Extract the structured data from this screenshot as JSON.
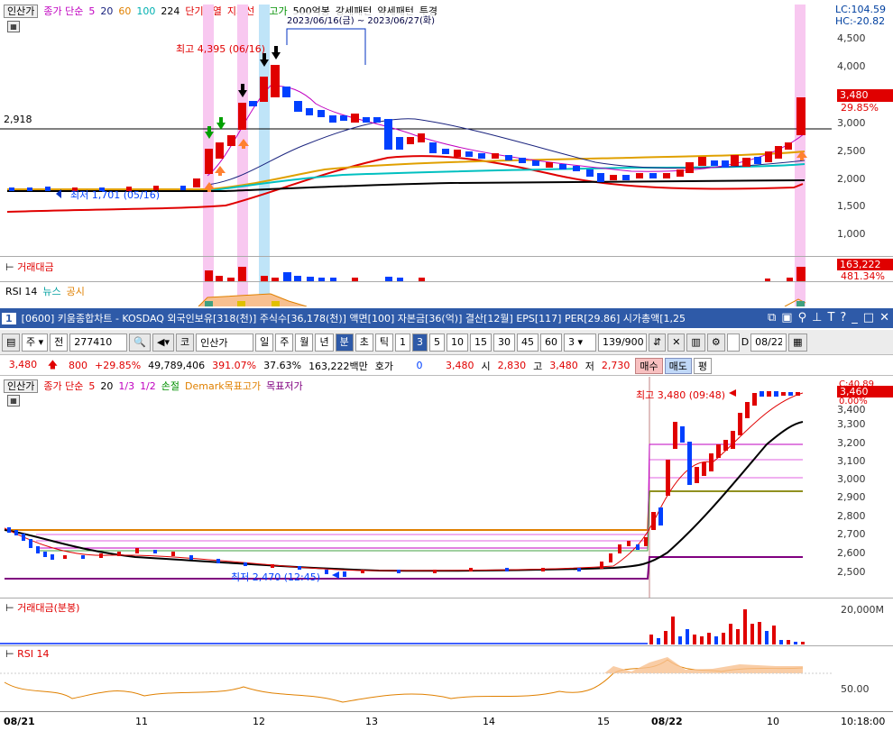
{
  "top_chart": {
    "legend": {
      "stock": "인산가",
      "ma_label": "종가 단순",
      "ma_periods": [
        "5",
        "20",
        "60",
        "100",
        "224"
      ],
      "ma_colors": [
        "#c000c0",
        "#1a237e",
        "#e08000",
        "#00c0c0",
        "#000000"
      ],
      "overheat": "단기과열",
      "support": "지지선",
      "new_high": "신고가",
      "pattern1": "500억봉",
      "pattern2": "강세패턴",
      "pattern3": "약세패턴",
      "pattern4": "투경"
    },
    "lc": "LC:104.59",
    "hc": "HC:-20.82",
    "range_label": "2023/06/16(금) ~ 2023/06/27(화)",
    "high_label": "최고 4,395 (06/16)",
    "low_label": "최저 1,701 (05/16)",
    "ref_line": "2,918",
    "price_badge": "3,480",
    "pct_badge": "29.85%",
    "y_ticks": [
      "4,500",
      "4,000",
      "3,500",
      "3,000",
      "2,500",
      "2,000",
      "1,500",
      "1,000"
    ],
    "volume_label": "거래대금",
    "volume_badge1": "163,222",
    "volume_badge2": "481.34%",
    "rsi_label": "RSI 14",
    "news_label": "뉴스",
    "disclosure_label": "공시"
  },
  "title_bar": {
    "number": "1",
    "text": "[0600] 키움종합차트 - KOSDAQ 외국인보유[318(천)] 주식수[36,178(천)] 액면[100] 자본금[36(억)] 결산[12월] EPS[117] PER[29.86] 시가총액[1,25"
  },
  "toolbar": {
    "type": "주",
    "mode": "전",
    "code": "277410",
    "name_prefix": "코",
    "name": "인산가",
    "periods": [
      "일",
      "주",
      "월",
      "년",
      "분",
      "초",
      "틱"
    ],
    "selected_period": "분",
    "minutes": [
      "1",
      "3",
      "5",
      "10",
      "15",
      "30",
      "45",
      "60"
    ],
    "selected_minute": "3",
    "count_value": "3",
    "range": "139/900",
    "d_label": "D",
    "date": "08/22"
  },
  "quote": {
    "price": "3,480",
    "change": "800",
    "change_pct": "+29.85%",
    "volume": "49,789,406",
    "vol_ratio": "391.07%",
    "turnover": "37.63%",
    "amount": "163,222백만",
    "hoga_label": "호가",
    "hoga": "0",
    "current": "3,480",
    "open_label": "시",
    "open": "2,830",
    "high_label": "고",
    "high": "3,480",
    "low_label": "저",
    "low": "2,730",
    "buy": "매수",
    "sell": "매도",
    "eval": "평"
  },
  "bottom_chart": {
    "legend": {
      "stock": "인산가",
      "ma_label": "종가 단순",
      "p1": "5",
      "p2": "20",
      "f1": "1/3",
      "f2": "1/2",
      "stop": "손절",
      "demark": "Demark목표고가",
      "target_low": "목표저가"
    },
    "high_label": "최고 3,480 (09:48)",
    "low_label": "최저 2,470 (12:45)",
    "c_badge": "C:40.89",
    "price_badge": "3,460",
    "pct_badge": "0.00%",
    "y_ticks": [
      "3,400",
      "3,300",
      "3,200",
      "3,100",
      "3,000",
      "2,900",
      "2,800",
      "2,700",
      "2,600",
      "2,500"
    ],
    "volume_label": "거래대금(분봉)",
    "volume_tick": "20,000M",
    "rsi_label": "RSI 14",
    "rsi_tick": "50.00",
    "x_ticks": [
      "08/21",
      "11",
      "12",
      "13",
      "14",
      "15",
      "08/22",
      "10"
    ],
    "time_label": "10:18:00"
  }
}
